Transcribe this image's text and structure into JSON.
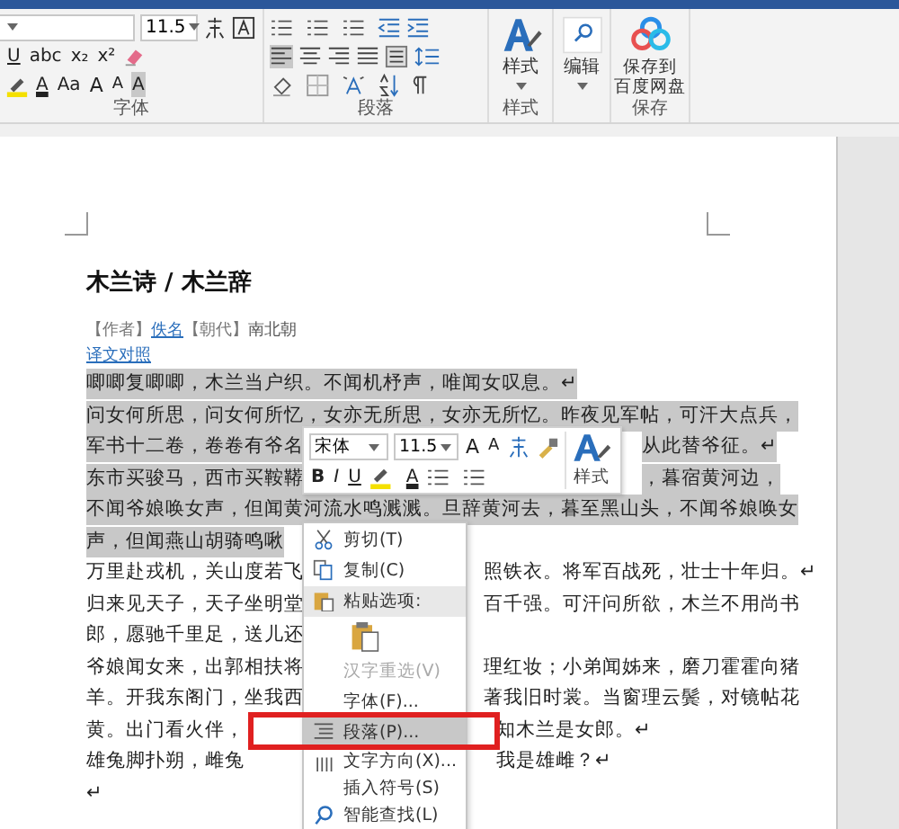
{
  "ribbon": {
    "font_size": "11.5",
    "font_row2": [
      "U",
      "abc",
      "x₂",
      "x²"
    ],
    "font_row3": [
      {
        "kind": "color",
        "text": "A"
      },
      {
        "kind": "case",
        "text": "Aa"
      },
      {
        "kind": "grow",
        "text": "A"
      },
      {
        "kind": "shrink",
        "text": "A"
      },
      {
        "kind": "shade",
        "text": "A"
      }
    ],
    "styles_button": "样式",
    "edit_button": "编辑",
    "save_button_lines": [
      "保存到",
      "百度网盘"
    ],
    "groups": [
      "字体",
      "段落",
      "样式",
      "保存"
    ]
  },
  "document": {
    "title": "木兰诗 / 木兰辞",
    "meta": [
      {
        "kind": "tag",
        "text": "【作者】"
      },
      {
        "kind": "link",
        "text": "佚名"
      },
      {
        "kind": "tag",
        "text": "【朝代】"
      },
      {
        "kind": "text",
        "text": "南北朝"
      }
    ],
    "translation_link": "译文对照",
    "lines": [
      {
        "kind": "full",
        "selected": true,
        "left": "唧唧复唧唧，木兰当户织。不闻机杼声，唯闻女叹息。↵"
      },
      {
        "kind": "full",
        "selected": true,
        "left": "问女何所思，问女何所忆，女亦无所思，女亦无所忆。昨夜见军帖，可汗大点兵，"
      },
      {
        "kind": "toolbar_gap",
        "selected": true,
        "left": "军书十二卷，卷卷有爷名",
        "right": "从此替爷征。↵"
      },
      {
        "kind": "toolbar_gap",
        "selected": true,
        "left": "东市买骏马，西市买鞍鞯",
        "right": "，暮宿黄河边，"
      },
      {
        "kind": "full",
        "selected": true,
        "left": "不闻爷娘唤女声，但闻黄河流水鸣溅溅。旦辞黄河去，暮至黑山头，不闻爷娘唤女"
      },
      {
        "kind": "menu_gap",
        "selected": true,
        "left": "声，但闻燕山胡骑鸣啾"
      },
      {
        "kind": "menu_gap",
        "selected": false,
        "left": "万里赴戎机，关山度若飞",
        "right": "照铁衣。将军百战死，壮士十年归。↵"
      },
      {
        "kind": "menu_gap",
        "selected": false,
        "left": "归来见天子，天子坐明堂",
        "right": "百千强。可汗问所欲，木兰不用尚书"
      },
      {
        "kind": "menu_gap",
        "selected": false,
        "left": "郎，愿驰千里足，送儿还"
      },
      {
        "kind": "menu_gap",
        "selected": false,
        "left": "爷娘闻女来，出郭相扶将",
        "right": "理红妆；小弟闻姊来，磨刀霍霍向猪"
      },
      {
        "kind": "menu_gap",
        "selected": false,
        "left": "羊。开我东阁门，坐我西",
        "right": "著我旧时裳。当窗理云鬓，对镜帖花"
      },
      {
        "kind": "frame_gap",
        "selected": false,
        "left": "黄。出门看火伴，",
        "right": "知木兰是女郎。↵"
      },
      {
        "kind": "frame_gap",
        "selected": false,
        "left": "雄兔脚扑朔，雌兔",
        "right": "我是雄雌？↵"
      },
      {
        "kind": "menu_gap",
        "selected": false,
        "left": "↵"
      }
    ]
  },
  "mini_toolbar": {
    "font": "宋体",
    "size": "11.5",
    "bold": "B",
    "italic": "I",
    "underline": "U",
    "font_color": "A",
    "grow": "A",
    "shrink": "A",
    "styles": "样式"
  },
  "context_menu": {
    "items": [
      {
        "kind": "item",
        "label": "剪切(T)",
        "disabled": false,
        "selected": false
      },
      {
        "kind": "item",
        "label": "复制(C)",
        "disabled": false,
        "selected": false
      },
      {
        "kind": "header",
        "label": "粘贴选项:"
      },
      {
        "kind": "paste"
      },
      {
        "kind": "item",
        "label": "汉字重选(V)",
        "disabled": true,
        "selected": false
      },
      {
        "kind": "item",
        "label": "字体(F)...",
        "disabled": false,
        "selected": false
      },
      {
        "kind": "item",
        "label": "段落(P)...",
        "disabled": false,
        "selected": true
      },
      {
        "kind": "item",
        "label": "文字方向(X)...",
        "disabled": false,
        "selected": false
      },
      {
        "kind": "item",
        "label": "插入符号(S)",
        "disabled": false,
        "selected": false
      },
      {
        "kind": "item",
        "label": "智能查找(L)",
        "disabled": false,
        "selected": false
      }
    ]
  }
}
